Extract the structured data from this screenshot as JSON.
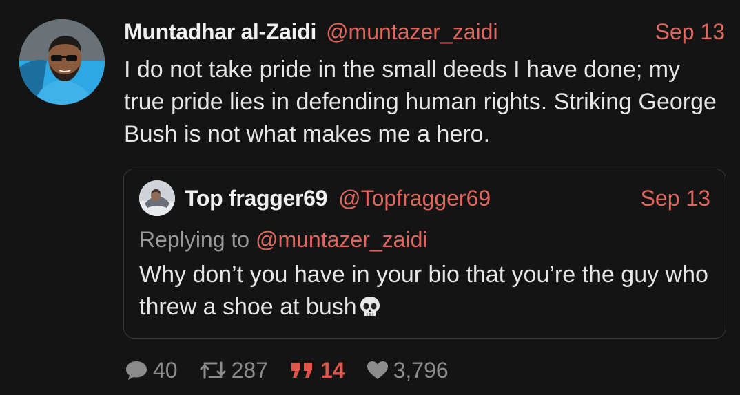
{
  "tweet": {
    "author": {
      "name": "Muntadhar al-Zaidi",
      "handle": "@muntazer_zaidi",
      "avatar_icon": "profile-photo"
    },
    "date": "Sep 13",
    "text": "I do not take pride in the small deeds I have done; my true pride lies in defending human rights. Striking George Bush is not what makes me a hero."
  },
  "quoted_tweet": {
    "author": {
      "name": "Top fragger69",
      "handle": "@Topfragger69",
      "avatar_icon": "profile-photo"
    },
    "date": "Sep 13",
    "replying_prefix": "Replying to ",
    "replying_to": "@muntazer_zaidi",
    "text": "Why don’t you have in your bio that you’re the guy who threw a shoe at bush",
    "emoji": "skull-emoji"
  },
  "stats": {
    "replies": "40",
    "retweets": "287",
    "quotes": "14",
    "likes": "3,796"
  },
  "colors": {
    "accent": "#e0675e",
    "background": "#141414",
    "text": "#e6e6e6",
    "muted": "#8c8c8c",
    "quote_active": "#e0564b"
  }
}
